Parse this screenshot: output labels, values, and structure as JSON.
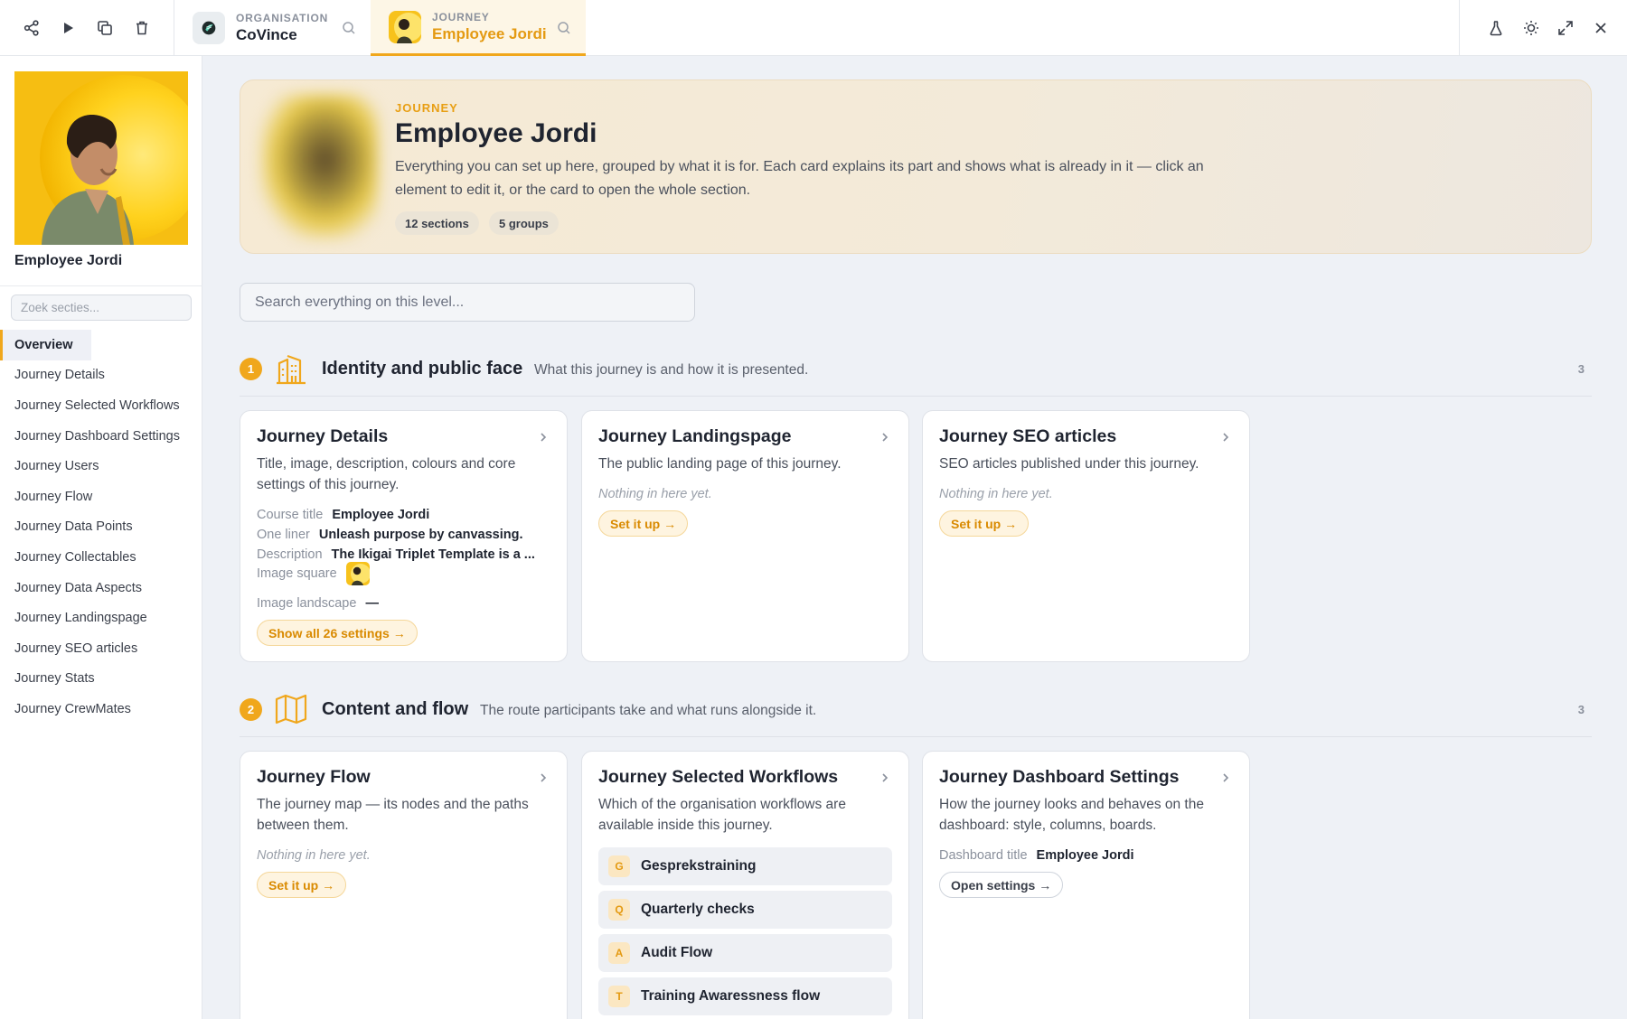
{
  "toolbar": {
    "icons": [
      "share-icon",
      "play-icon",
      "copy-icon",
      "trash-icon"
    ],
    "right_icons": [
      "flask-icon",
      "sun-icon",
      "expand-icon",
      "close-icon"
    ]
  },
  "context_tabs": [
    {
      "kind": "ORGANISATION",
      "name": "CoVince"
    },
    {
      "kind": "JOURNEY",
      "name": "Employee Jordi"
    }
  ],
  "sidebar": {
    "title": "Employee Jordi",
    "search_placeholder": "Zoek secties...",
    "items": [
      {
        "label": "Overview",
        "active": true
      },
      {
        "label": "Journey Details"
      },
      {
        "label": "Journey Selected Workflows"
      },
      {
        "label": "Journey Dashboard Settings"
      },
      {
        "label": "Journey Users"
      },
      {
        "label": "Journey Flow"
      },
      {
        "label": "Journey Data Points"
      },
      {
        "label": "Journey Collectables"
      },
      {
        "label": "Journey Data Aspects"
      },
      {
        "label": "Journey Landingspage"
      },
      {
        "label": "Journey SEO articles"
      },
      {
        "label": "Journey Stats"
      },
      {
        "label": "Journey CrewMates"
      }
    ]
  },
  "hero": {
    "kind": "JOURNEY",
    "title": "Employee Jordi",
    "description": "Everything you can set up here, grouped by what it is for. Each card explains its part and shows what is already in it — click an element to edit it, or the card to open the whole section.",
    "chips": [
      "12 sections",
      "5 groups"
    ]
  },
  "search": {
    "placeholder": "Search everything on this level..."
  },
  "groups": [
    {
      "number": "1",
      "icon": "building-icon",
      "title": "Identity and public face",
      "subtitle": "What this journey is and how it is presented.",
      "count": "3",
      "cards": [
        {
          "title": "Journey Details",
          "description": "Title, image, description, colours and core settings of this journey.",
          "fields": [
            {
              "label": "Course title",
              "value": "Employee Jordi"
            },
            {
              "label": "One liner",
              "value": "Unleash purpose by canvassing."
            },
            {
              "label": "Description",
              "value": "The Ikigai Triplet Template is a ..."
            },
            {
              "label": "Image square",
              "value": ""
            },
            {
              "label": "Image landscape",
              "value": "—"
            }
          ],
          "action": "Show all 26 settings →"
        },
        {
          "title": "Journey Landingspage",
          "description": "The public landing page of this journey.",
          "empty": "Nothing in here yet.",
          "action": "Set it up →"
        },
        {
          "title": "Journey SEO articles",
          "description": "SEO articles published under this journey.",
          "empty": "Nothing in here yet.",
          "action": "Set it up →"
        }
      ]
    },
    {
      "number": "2",
      "icon": "map-icon",
      "title": "Content and flow",
      "subtitle": "The route participants take and what runs alongside it.",
      "count": "3",
      "cards": [
        {
          "title": "Journey Flow",
          "description": "The journey map — its nodes and the paths between them.",
          "empty": "Nothing in here yet.",
          "action": "Set it up →"
        },
        {
          "title": "Journey Selected Workflows",
          "description": "Which of the organisation workflows are available inside this journey.",
          "workflows": [
            {
              "badge": "G",
              "label": "Gesprekstraining"
            },
            {
              "badge": "Q",
              "label": "Quarterly checks"
            },
            {
              "badge": "A",
              "label": "Audit Flow"
            },
            {
              "badge": "T",
              "label": "Training Awaressness flow"
            }
          ]
        },
        {
          "title": "Journey Dashboard Settings",
          "description": "How the journey looks and behaves on the dashboard: style, columns, boards.",
          "fields": [
            {
              "label": "Dashboard title",
              "value": "Employee Jordi"
            }
          ],
          "action": "Open settings →"
        }
      ]
    }
  ],
  "colors": {
    "accent": "#f0a71c",
    "accent_text": "#e49a12",
    "background": "#eef1f6"
  }
}
